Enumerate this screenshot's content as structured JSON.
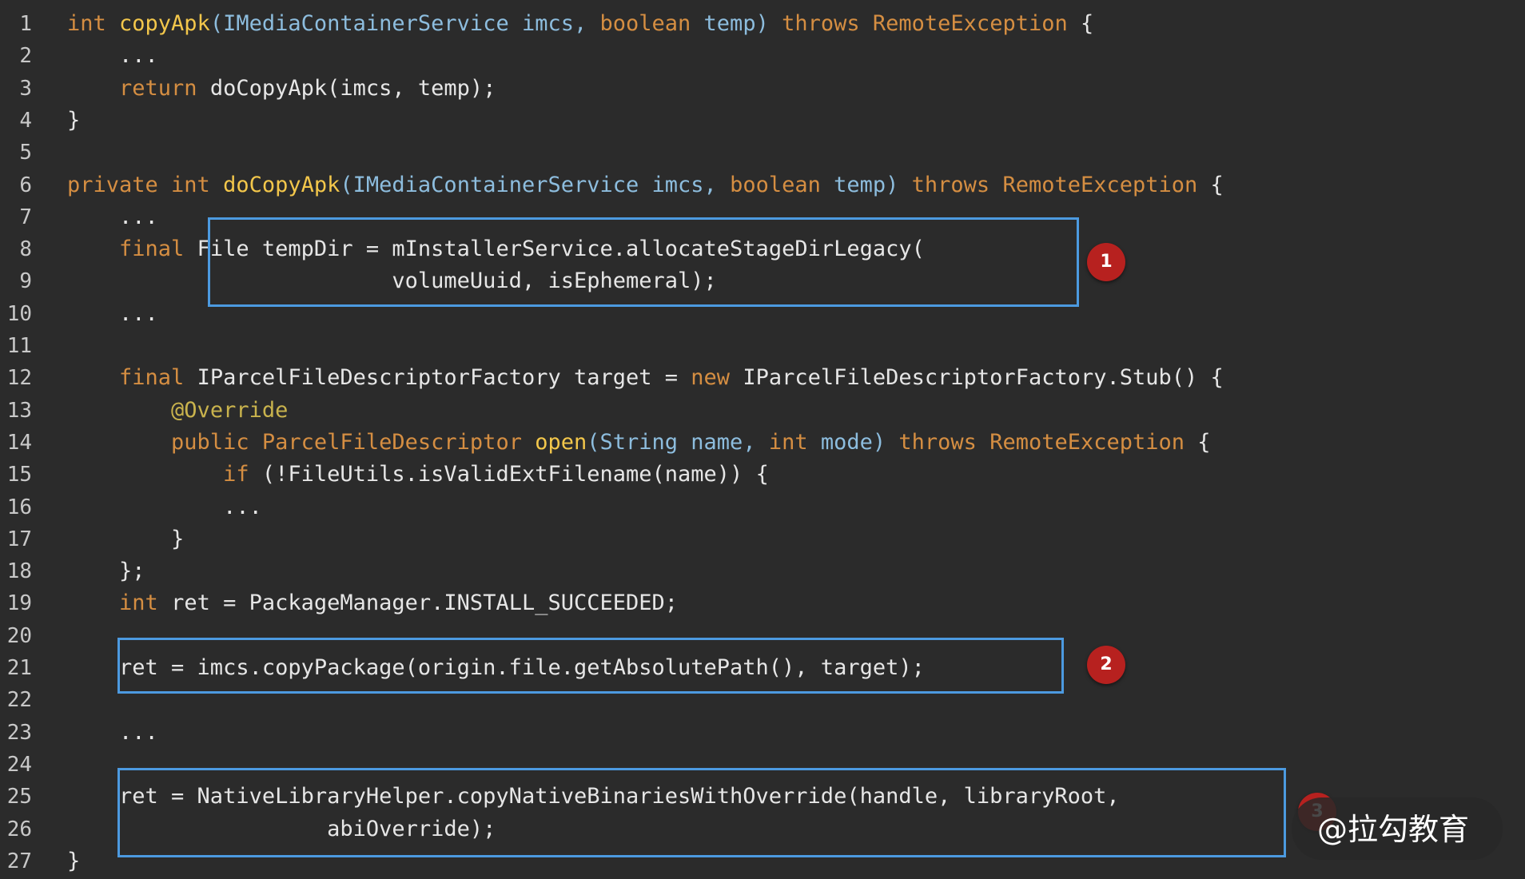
{
  "colors": {
    "background": "#2b2b2b",
    "keyword": "#d58e42",
    "function": "#f3c74b",
    "type": "#8dbdde",
    "annotation": "#c9b34d",
    "plain": "#e6e6e6",
    "highlight_border": "#4c9ae0",
    "marker_fill": "#b7211f"
  },
  "lines": [
    {
      "n": "1",
      "tokens": [
        {
          "t": "int ",
          "c": "kw"
        },
        {
          "t": "copyApk",
          "c": "fn"
        },
        {
          "t": "(IMediaContainerService imcs, ",
          "c": "ty"
        },
        {
          "t": "boolean ",
          "c": "kw"
        },
        {
          "t": "temp) ",
          "c": "ty"
        },
        {
          "t": "throws ",
          "c": "kw"
        },
        {
          "t": "RemoteException ",
          "c": "kw"
        },
        {
          "t": "{",
          "c": "pl"
        }
      ]
    },
    {
      "n": "2",
      "tokens": [
        {
          "t": "    ...",
          "c": "pl"
        }
      ]
    },
    {
      "n": "3",
      "tokens": [
        {
          "t": "    ",
          "c": "pl"
        },
        {
          "t": "return ",
          "c": "kw"
        },
        {
          "t": "doCopyApk(imcs, temp);",
          "c": "pl"
        }
      ]
    },
    {
      "n": "4",
      "tokens": [
        {
          "t": "}",
          "c": "pl"
        }
      ]
    },
    {
      "n": "5",
      "tokens": []
    },
    {
      "n": "6",
      "tokens": [
        {
          "t": "private ",
          "c": "kw"
        },
        {
          "t": "int ",
          "c": "kw"
        },
        {
          "t": "doCopyApk",
          "c": "fn"
        },
        {
          "t": "(IMediaContainerService imcs, ",
          "c": "ty"
        },
        {
          "t": "boolean ",
          "c": "kw"
        },
        {
          "t": "temp) ",
          "c": "ty"
        },
        {
          "t": "throws ",
          "c": "kw"
        },
        {
          "t": "RemoteException ",
          "c": "kw"
        },
        {
          "t": "{",
          "c": "pl"
        }
      ]
    },
    {
      "n": "7",
      "tokens": [
        {
          "t": "    ...",
          "c": "pl"
        }
      ]
    },
    {
      "n": "8",
      "tokens": [
        {
          "t": "    ",
          "c": "pl"
        },
        {
          "t": "final ",
          "c": "kw"
        },
        {
          "t": "File tempDir = mInstallerService.allocateStageDirLegacy(",
          "c": "pl"
        }
      ]
    },
    {
      "n": "9",
      "tokens": [
        {
          "t": "                         volumeUuid, isEphemeral);",
          "c": "pl"
        }
      ]
    },
    {
      "n": "10",
      "tokens": [
        {
          "t": "    ...",
          "c": "pl"
        }
      ]
    },
    {
      "n": "11",
      "tokens": []
    },
    {
      "n": "12",
      "tokens": [
        {
          "t": "    ",
          "c": "pl"
        },
        {
          "t": "final ",
          "c": "kw"
        },
        {
          "t": "IParcelFileDescriptorFactory target = ",
          "c": "pl"
        },
        {
          "t": "new ",
          "c": "kw"
        },
        {
          "t": "IParcelFileDescriptorFactory.Stub() {",
          "c": "pl"
        }
      ]
    },
    {
      "n": "13",
      "tokens": [
        {
          "t": "        ",
          "c": "pl"
        },
        {
          "t": "@Override",
          "c": "an"
        }
      ]
    },
    {
      "n": "14",
      "tokens": [
        {
          "t": "        ",
          "c": "pl"
        },
        {
          "t": "public ",
          "c": "kw"
        },
        {
          "t": "ParcelFileDescriptor ",
          "c": "kw"
        },
        {
          "t": "open",
          "c": "fn"
        },
        {
          "t": "(String name, ",
          "c": "ty"
        },
        {
          "t": "int ",
          "c": "kw"
        },
        {
          "t": "mode) ",
          "c": "ty"
        },
        {
          "t": "throws ",
          "c": "kw"
        },
        {
          "t": "RemoteException ",
          "c": "kw"
        },
        {
          "t": "{",
          "c": "pl"
        }
      ]
    },
    {
      "n": "15",
      "tokens": [
        {
          "t": "            ",
          "c": "pl"
        },
        {
          "t": "if ",
          "c": "kw"
        },
        {
          "t": "(!FileUtils.isValidExtFilename(name)) {",
          "c": "pl"
        }
      ]
    },
    {
      "n": "16",
      "tokens": [
        {
          "t": "            ...",
          "c": "pl"
        }
      ]
    },
    {
      "n": "17",
      "tokens": [
        {
          "t": "        }",
          "c": "pl"
        }
      ]
    },
    {
      "n": "18",
      "tokens": [
        {
          "t": "    };",
          "c": "pl"
        }
      ]
    },
    {
      "n": "19",
      "tokens": [
        {
          "t": "    ",
          "c": "pl"
        },
        {
          "t": "int ",
          "c": "kw"
        },
        {
          "t": "ret = PackageManager.INSTALL_SUCCEEDED;",
          "c": "pl"
        }
      ]
    },
    {
      "n": "20",
      "tokens": []
    },
    {
      "n": "21",
      "tokens": [
        {
          "t": "    ret = imcs.copyPackage(origin.file.getAbsolutePath(), target);",
          "c": "pl"
        }
      ]
    },
    {
      "n": "22",
      "tokens": []
    },
    {
      "n": "23",
      "tokens": [
        {
          "t": "    ...",
          "c": "pl"
        }
      ]
    },
    {
      "n": "24",
      "tokens": []
    },
    {
      "n": "25",
      "tokens": [
        {
          "t": "    ret = NativeLibraryHelper.copyNativeBinariesWithOverride(handle, libraryRoot,",
          "c": "pl"
        }
      ]
    },
    {
      "n": "26",
      "tokens": [
        {
          "t": "                    abiOverride);",
          "c": "pl"
        }
      ]
    },
    {
      "n": "27",
      "tokens": [
        {
          "t": "}",
          "c": "pl"
        }
      ]
    }
  ],
  "markers": [
    {
      "label": "1"
    },
    {
      "label": "2"
    },
    {
      "label": "3"
    }
  ],
  "watermark": "@拉勾教育"
}
